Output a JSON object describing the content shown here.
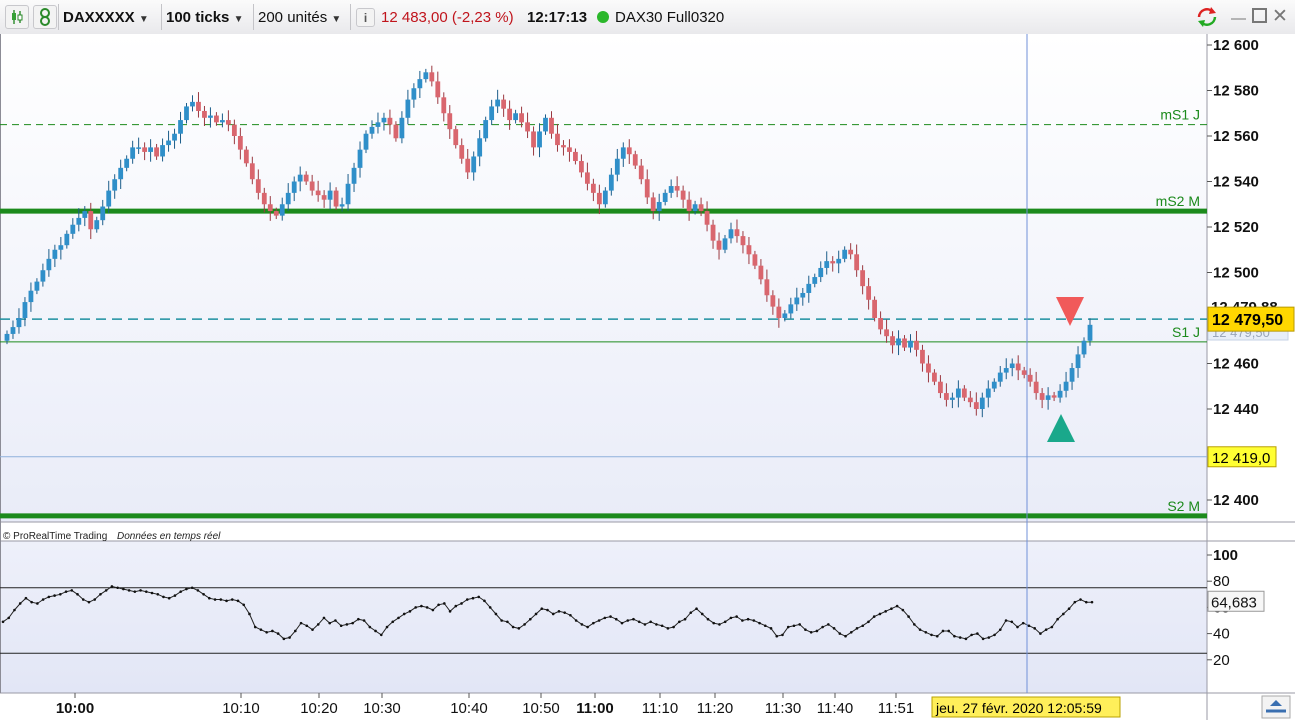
{
  "toolbar": {
    "instrument": "DAXXXXX",
    "ticks": "100 ticks",
    "units": "200 unités",
    "price_change": "12 483,00 (-2,23 %)",
    "time": "12:17:13",
    "contract": "DAX30 Full0320",
    "icons": [
      "candlestick-icon",
      "link-icon",
      "info-icon",
      "status-dot-icon",
      "refresh-icon",
      "minimize-icon",
      "maximize-icon",
      "close-icon"
    ]
  },
  "footer": {
    "credit": "© ProRealTime Trading",
    "realtime": "Données en temps réel",
    "crosshair_time": "jeu. 27 févr. 2020 12:05:59"
  },
  "colors": {
    "bull": "#2f8fc9",
    "bear": "#d9666e",
    "support_level": "#1c8a1c",
    "price_tag": "#ffd700",
    "signal_up": "#1aa88b",
    "signal_down": "#f15a5a"
  },
  "chart_data": [
    {
      "type": "candlestick",
      "y_ticks": [
        "12 600",
        "12 580",
        "12 560",
        "12 540",
        "12 520",
        "12 500",
        "12 460",
        "12 440",
        "12 400"
      ],
      "ylim": [
        12391,
        12609
      ],
      "x_tick_labels": [
        "10:00",
        "10:10",
        "10:20",
        "10:30",
        "10:40",
        "10:50",
        "11:00",
        "11:10",
        "11:20",
        "11:30",
        "11:40",
        "11:51"
      ],
      "levels": [
        {
          "label": "mS1 J",
          "value": 12565,
          "style": "dashed-thin"
        },
        {
          "label": "mS2 M",
          "value": 12527,
          "style": "solid-thick"
        },
        {
          "label": "",
          "value": 12479.5,
          "style": "dashed-teal"
        },
        {
          "label": "S1 J",
          "value": 12469.5,
          "style": "solid-thin"
        },
        {
          "label": "",
          "value": 12419,
          "style": "solid-blue-thin"
        },
        {
          "label": "S2 M",
          "value": 12393,
          "style": "solid-thick"
        }
      ],
      "last_price": "12 479,50",
      "price_tag_level": "12 419,0",
      "hidden_price_labels": [
        "12 479,88",
        "12 479,50"
      ],
      "close_path": [
        12473,
        12476,
        12480,
        12487,
        12492,
        12496,
        12501,
        12506,
        12510,
        12512,
        12517,
        12521,
        12524,
        12527,
        12519,
        12523,
        12529,
        12536,
        12541,
        12546,
        12550,
        12555,
        12555,
        12553,
        12555,
        12551,
        12556,
        12558,
        12561,
        12567,
        12573,
        12575,
        12571,
        12568,
        12569,
        12566,
        12567,
        12565,
        12560,
        12554,
        12548,
        12541,
        12535,
        12530,
        12527,
        12525,
        12530,
        12535,
        12540,
        12543,
        12540,
        12536,
        12534,
        12532,
        12536,
        12529,
        12530,
        12539,
        12546,
        12554,
        12561,
        12564,
        12566,
        12568,
        12565,
        12559,
        12568,
        12576,
        12581,
        12585,
        12588,
        12584,
        12577,
        12570,
        12563,
        12556,
        12550,
        12544,
        12551,
        12559,
        12567,
        12573,
        12576,
        12572,
        12567,
        12570,
        12566,
        12562,
        12555,
        12562,
        12568,
        12561,
        12556,
        12555,
        12553,
        12549,
        12544,
        12539,
        12535,
        12530,
        12536,
        12543,
        12550,
        12555,
        12552,
        12547,
        12541,
        12533,
        12527,
        12531,
        12535,
        12538,
        12536,
        12532,
        12527,
        12530,
        12527,
        12521,
        12514,
        12510,
        12515,
        12519,
        12516,
        12512,
        12508,
        12503,
        12497,
        12490,
        12485,
        12480,
        12482,
        12486,
        12489,
        12491,
        12495,
        12498,
        12502,
        12505,
        12504,
        12506,
        12510,
        12508,
        12501,
        12494,
        12488,
        12480,
        12475,
        12472,
        12468,
        12471,
        12467,
        12470,
        12466,
        12460,
        12456,
        12452,
        12447,
        12444,
        12445,
        12449,
        12445,
        12443,
        12440,
        12445,
        12449,
        12452,
        12456,
        12458,
        12460,
        12457,
        12455,
        12452,
        12447,
        12444,
        12446,
        12445,
        12448,
        12452,
        12458,
        12464,
        12470,
        12477
      ],
      "ohlc_sample_last": {
        "open": 12473,
        "high": 12481,
        "low": 12471,
        "close": 12479.5
      }
    },
    {
      "type": "line",
      "name": "oscillator",
      "y_ticks": [
        "100",
        "80",
        "60",
        "40",
        "20"
      ],
      "ylim": [
        0,
        110
      ],
      "band_levels": [
        75,
        25
      ],
      "last_value": "64,683",
      "values": [
        49,
        52,
        58,
        63,
        67,
        64,
        63,
        66,
        68,
        69,
        70,
        72,
        73,
        70,
        66,
        64,
        66,
        70,
        73,
        76,
        75,
        74,
        73,
        72,
        73,
        72,
        71,
        70,
        68,
        67,
        69,
        72,
        74,
        75,
        73,
        70,
        67,
        66,
        66,
        65,
        66,
        65,
        62,
        55,
        45,
        43,
        41,
        42,
        40,
        36,
        37,
        42,
        48,
        46,
        43,
        47,
        52,
        48,
        50,
        46,
        47,
        48,
        51,
        50,
        45,
        42,
        39,
        45,
        49,
        52,
        55,
        57,
        60,
        61,
        60,
        58,
        62,
        63,
        57,
        61,
        63,
        66,
        67,
        68,
        65,
        60,
        55,
        50,
        49,
        45,
        44,
        47,
        51,
        55,
        59,
        58,
        55,
        57,
        56,
        54,
        50,
        47,
        45,
        48,
        50,
        52,
        53,
        51,
        48,
        50,
        51,
        49,
        47,
        49,
        47,
        46,
        44,
        45,
        49,
        51,
        56,
        59,
        55,
        51,
        48,
        47,
        49,
        52,
        53,
        50,
        51,
        50,
        48,
        46,
        44,
        38,
        39,
        45,
        46,
        47,
        43,
        41,
        42,
        45,
        47,
        44,
        40,
        38,
        41,
        44,
        46,
        49,
        53,
        55,
        57,
        59,
        61,
        58,
        53,
        47,
        43,
        41,
        39,
        38,
        42,
        42,
        38,
        37,
        36,
        39,
        40,
        36,
        37,
        39,
        43,
        50,
        49,
        45,
        48,
        46,
        44,
        40,
        43,
        45,
        51,
        55,
        59,
        64,
        66,
        64,
        64
      ]
    }
  ]
}
